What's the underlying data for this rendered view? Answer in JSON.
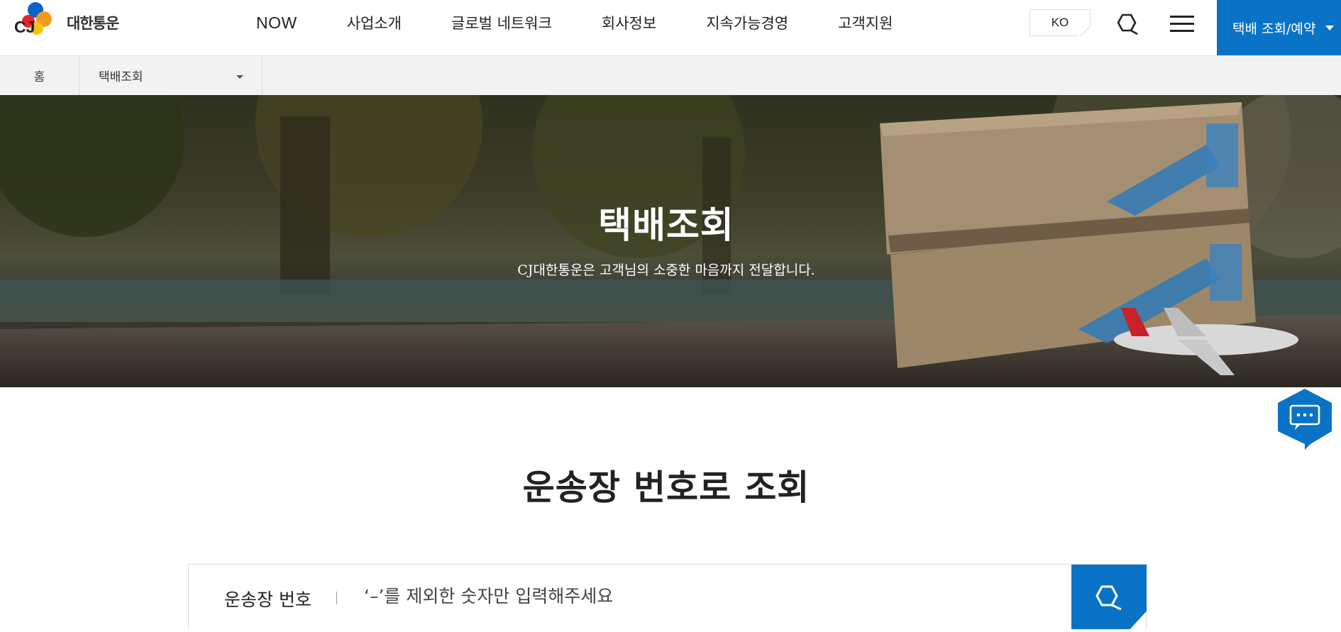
{
  "header": {
    "logo_mark": "CJ",
    "logo_text": "대한통운",
    "nav": [
      "NOW",
      "사업소개",
      "글로벌 네트워크",
      "회사정보",
      "지속가능경영",
      "고객지원"
    ],
    "lang": "KO",
    "track_button": "택배 조회/예약",
    "brand_color": "#0a73c6"
  },
  "breadcrumb": {
    "home": "홈",
    "current": "택배조회"
  },
  "hero": {
    "title": "택배조회",
    "subtitle": "CJ대한통운은 고객님의 소중한 마음까지 전달합니다."
  },
  "main": {
    "section_title": "운송장 번호로 조회",
    "search_label": "운송장 번호",
    "search_placeholder": "‘–’를 제외한 숫자만 입력해주세요",
    "search_value": ""
  },
  "icons": {
    "search": "search-icon",
    "menu": "hamburger-menu-icon",
    "chat": "chat-icon"
  }
}
